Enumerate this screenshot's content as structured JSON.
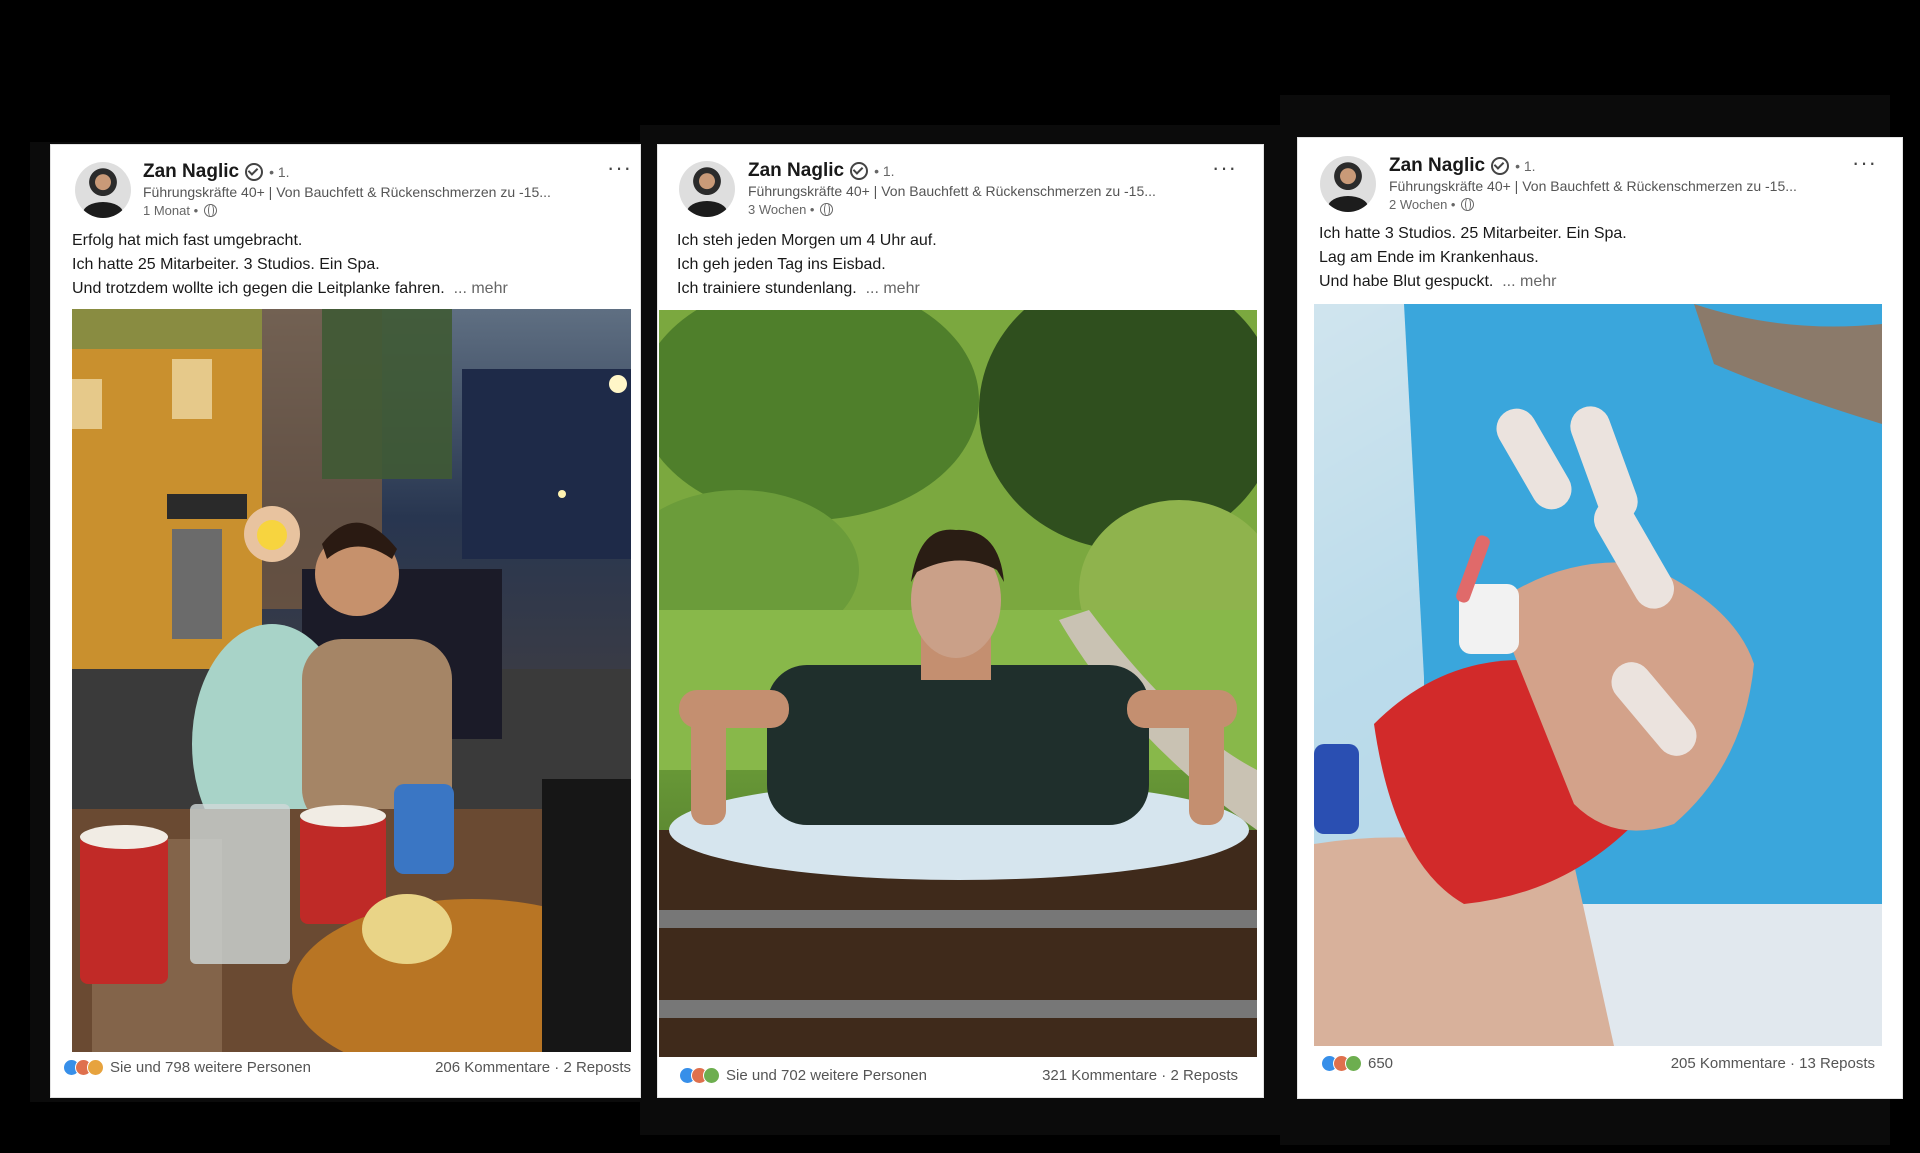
{
  "posts": [
    {
      "author": "Zan Naglic",
      "degree": "• 1.",
      "headline": "Führungskräfte 40+ | Von Bauchfett & Rückenschmerzen zu -15...",
      "time": "1 Monat •",
      "text": [
        "Erfolg hat mich fast umgebracht.",
        "Ich hatte 25 Mitarbeiter. 3 Studios. Ein Spa.",
        "Und trotzdem wollte ich gegen die Leitplanke fahren."
      ],
      "more": "... mehr",
      "reactions_text": "Sie und 798 weitere Personen",
      "stats": "206 Kommentare · 2 Reposts",
      "image": "man-holding-baby-at-night-cafe"
    },
    {
      "author": "Zan Naglic",
      "degree": "• 1.",
      "headline": "Führungskräfte 40+ | Von Bauchfett & Rückenschmerzen zu -15...",
      "time": "3 Wochen •",
      "text": [
        "Ich steh jeden Morgen um 4 Uhr auf.",
        "Ich geh jeden Tag ins Eisbad.",
        "Ich trainiere stundenlang."
      ],
      "more": "... mehr",
      "reactions_text": "Sie und 702 weitere Personen",
      "stats": "321 Kommentare · 2 Reposts",
      "image": "man-in-ice-barrel-bath"
    },
    {
      "author": "Zan Naglic",
      "degree": "• 1.",
      "headline": "Führungskräfte 40+ | Von Bauchfett & Rückenschmerzen zu -15...",
      "time": "2 Wochen •",
      "text": [
        "Ich hatte 3 Studios. 25 Mitarbeiter. Ein Spa.",
        "Lag am Ende im Krankenhaus.",
        "Und habe Blut gespuckt."
      ],
      "more": "... mehr",
      "reactions_text": "650",
      "stats": "205 Kommentare · 13 Reposts",
      "image": "hospital-hand-with-iv-and-bandage"
    }
  ],
  "colors": {
    "like": "#378fe9",
    "love": "#df704d",
    "celebrate": "#6dae4f",
    "insightful": "#e7a33e"
  }
}
